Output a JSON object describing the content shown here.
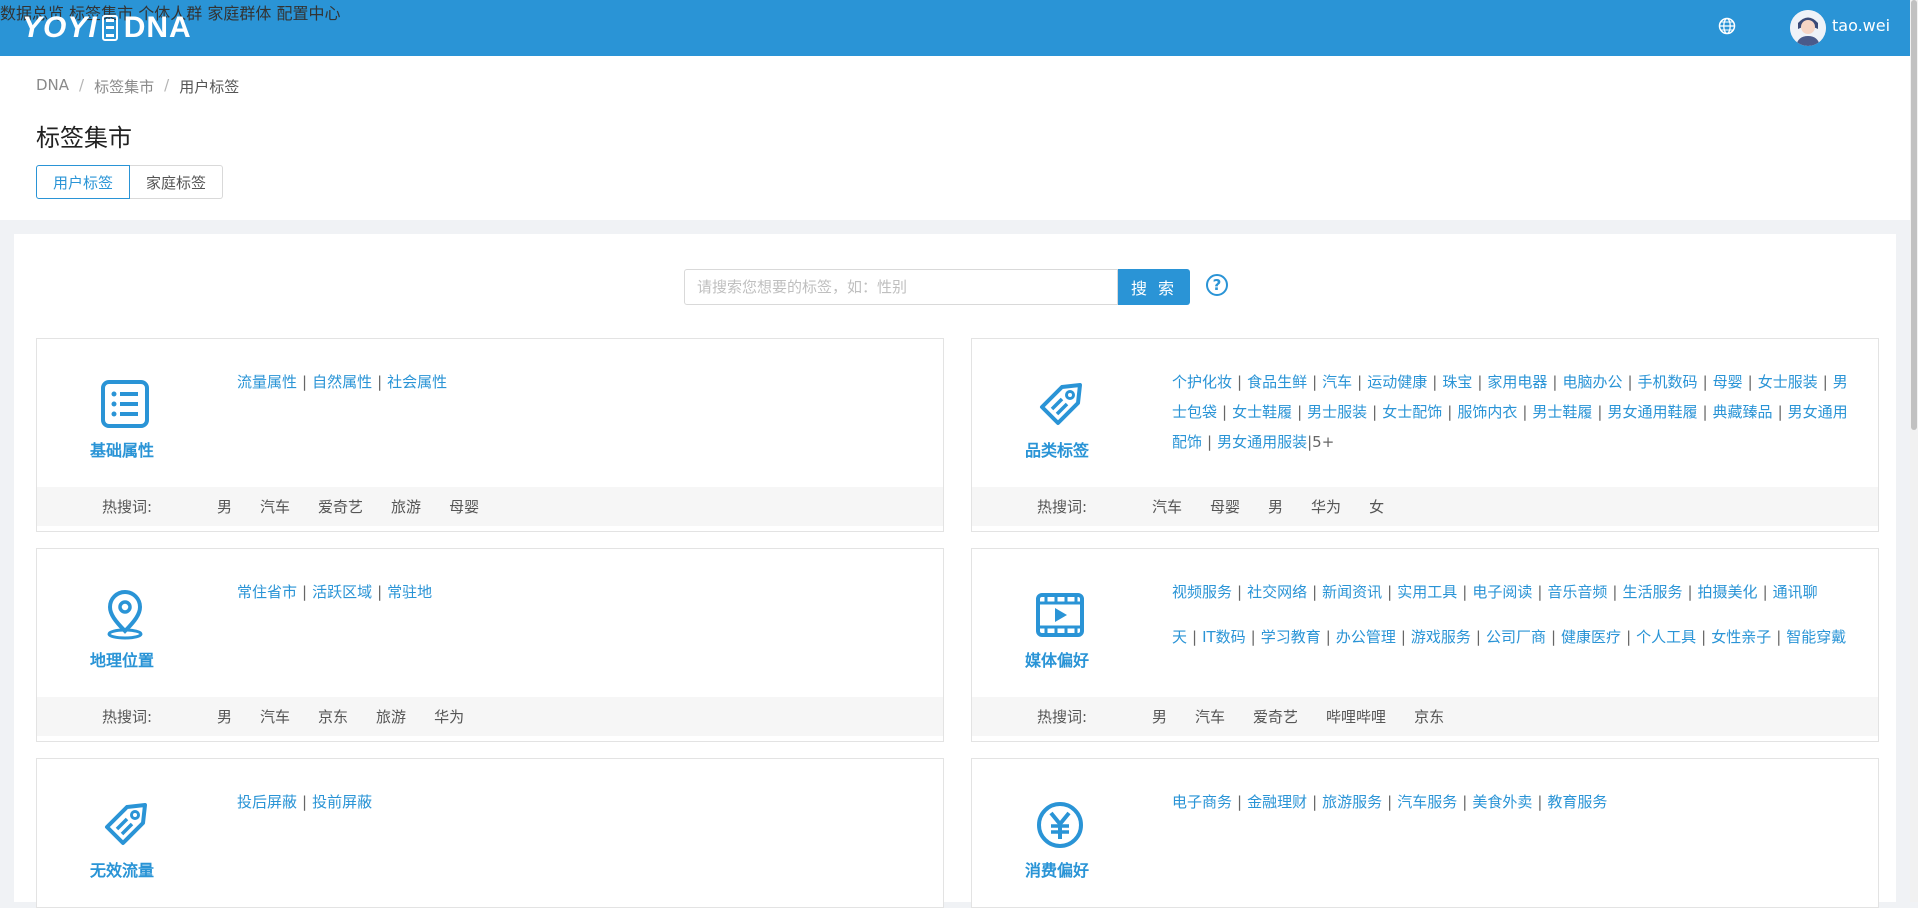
{
  "brand": {
    "logo_text": "YOYI",
    "product": "DNA"
  },
  "nav": [
    "数据总览",
    "标签集市",
    "个体人群",
    "家庭群体",
    "配置中心"
  ],
  "user": {
    "name": "tao.wei"
  },
  "breadcrumb": [
    "DNA",
    "标签集市",
    "用户标签"
  ],
  "page_title": "标签集市",
  "tabs": [
    "用户标签",
    "家庭标签"
  ],
  "search": {
    "placeholder": "请搜索您想要的标签，如：性别",
    "button": "搜 索",
    "help": "?"
  },
  "hot_label": "热搜词:",
  "cards": [
    {
      "title": "基础属性",
      "icon": "list-icon",
      "links": [
        "流量属性",
        "自然属性",
        "社会属性"
      ],
      "hot": [
        "男",
        "汽车",
        "爱奇艺",
        "旅游",
        "母婴"
      ]
    },
    {
      "title": "品类标签",
      "icon": "tag-icon",
      "links": [
        "个护化妆",
        "食品生鲜",
        "汽车",
        "运动健康",
        "珠宝",
        "家用电器",
        "电脑办公",
        "手机数码",
        "母婴",
        "女士服装",
        "男士包袋",
        "女士鞋履",
        "男士服装",
        "女士配饰",
        "服饰内衣",
        "男士鞋履",
        "男女通用鞋履",
        "典藏臻品",
        "男女通用配饰",
        "男女通用服装"
      ],
      "more": "|5+",
      "hot": [
        "汽车",
        "母婴",
        "男",
        "华为",
        "女"
      ]
    },
    {
      "title": "地理位置",
      "icon": "location-icon",
      "links": [
        "常住省市",
        "活跃区域",
        "常驻地"
      ],
      "hot": [
        "男",
        "汽车",
        "京东",
        "旅游",
        "华为"
      ]
    },
    {
      "title": "媒体偏好",
      "icon": "video-icon",
      "links": [
        "视频服务",
        "社交网络",
        "新闻资讯",
        "实用工具",
        "电子阅读",
        "音乐音频",
        "生活服务",
        "拍摄美化",
        "通讯聊天",
        "IT数码",
        "学习教育",
        "办公管理",
        "游戏服务",
        "公司厂商",
        "健康医疗",
        "个人工具",
        "女性亲子",
        "智能穿戴"
      ],
      "hot": [
        "男",
        "汽车",
        "爱奇艺",
        "哔哩哔哩",
        "京东"
      ]
    },
    {
      "title": "无效流量",
      "icon": "tag-icon",
      "links": [
        "投后屏蔽",
        "投前屏蔽"
      ],
      "hot": []
    },
    {
      "title": "消费偏好",
      "icon": "yuan-icon",
      "links": [
        "电子商务",
        "金融理财",
        "旅游服务",
        "汽车服务",
        "美食外卖",
        "教育服务"
      ],
      "hot": []
    }
  ],
  "colors": {
    "primary": "#2a94d6",
    "topbar": "#2a94d6"
  }
}
